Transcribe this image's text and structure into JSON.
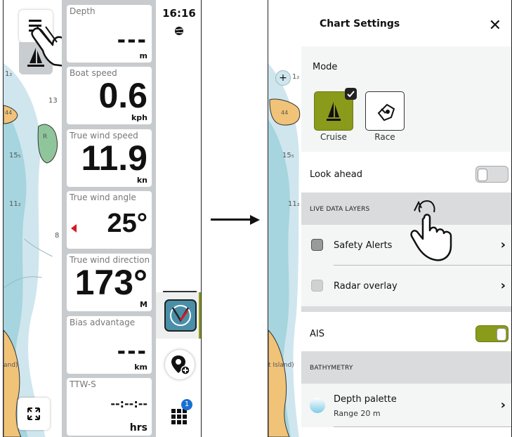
{
  "left_screen": {
    "map_depths": [
      "1₂",
      "13",
      "15₅",
      "11₂",
      "44",
      "R",
      "8"
    ],
    "map_land_label": "and)",
    "tiles": [
      {
        "label": "Depth",
        "value": "---",
        "unit": "m"
      },
      {
        "label": "Boat speed",
        "value": "0.6",
        "unit": "kph"
      },
      {
        "label": "True wind speed",
        "value": "11.9",
        "unit": "kn"
      },
      {
        "label": "True wind angle",
        "value": "25°",
        "unit": ""
      },
      {
        "label": "True wind direction",
        "value": "173°",
        "unit": "M"
      },
      {
        "label": "Bias advantage",
        "value": "---",
        "unit": "km"
      },
      {
        "label": "TTW-S",
        "value": "--:--:--",
        "unit": "hrs"
      }
    ],
    "rail": {
      "time": "16:16",
      "badge_count": "1"
    }
  },
  "right_screen": {
    "title": "Chart Settings",
    "map_depths": [
      "1₂",
      "44",
      "15₅",
      "11₂"
    ],
    "map_land_label": "t Island)",
    "mode": {
      "label": "Mode",
      "options": [
        {
          "label": "Cruise",
          "selected": true
        },
        {
          "label": "Race",
          "selected": false
        }
      ]
    },
    "look_ahead": {
      "label": "Look ahead",
      "enabled": false
    },
    "live_data_layers": {
      "header": "LIVE DATA LAYERS",
      "items": [
        {
          "label": "Safety Alerts",
          "checked": false
        },
        {
          "label": "Radar overlay",
          "checked": false
        }
      ]
    },
    "ais": {
      "label": "AIS",
      "enabled": true
    },
    "bathymetry": {
      "header": "BATHYMETRY",
      "items": [
        {
          "label": "Depth palette",
          "sublabel": "Range 20 m"
        }
      ]
    }
  },
  "colors": {
    "accent": "#8a9a1b",
    "sea_deep": "#ffffff",
    "sea_shallow": "#cfe6ee",
    "sea_shallower": "#a6d4df",
    "land": "#f1c378",
    "wind_marker": "#d71920",
    "badge": "#1a6fd1"
  }
}
